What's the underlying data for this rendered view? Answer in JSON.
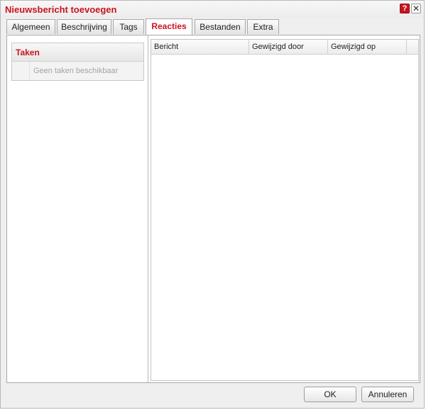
{
  "dialog": {
    "title": "Nieuwsbericht toevoegen",
    "help_label": "?",
    "close_label": "✕"
  },
  "tabs": [
    {
      "label": "Algemeen"
    },
    {
      "label": "Beschrijving"
    },
    {
      "label": "Tags"
    },
    {
      "label": "Reacties",
      "active": true
    },
    {
      "label": "Bestanden"
    },
    {
      "label": "Extra"
    }
  ],
  "taken": {
    "title": "Taken",
    "empty_text": "Geen taken beschikbaar"
  },
  "grid": {
    "columns": [
      "Bericht",
      "Gewijzigd door",
      "Gewijzigd op"
    ],
    "rows": []
  },
  "footer": {
    "ok_label": "OK",
    "cancel_label": "Annuleren"
  },
  "colors": {
    "accent": "#c8141e",
    "muted_text": "#a3a3a3"
  }
}
